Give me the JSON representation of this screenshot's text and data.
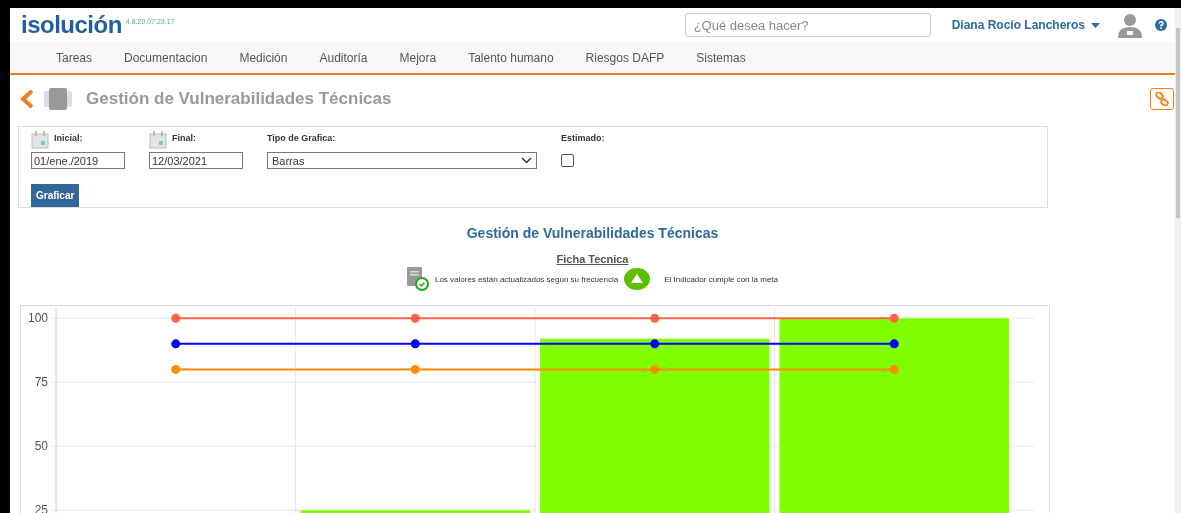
{
  "header": {
    "logo": "isolución",
    "version": "4.8.20.07.23.17",
    "search": {
      "placeholder": "¿Qué desea hacer?"
    },
    "user": "Diana Rocío Lancheros"
  },
  "nav": {
    "items": [
      "Tareas",
      "Documentacion",
      "Medición",
      "Auditoría",
      "Mejora",
      "Talento humano",
      "Riesgos DAFP",
      "Sistemas"
    ]
  },
  "page": {
    "title": "Gestión de Vulnerabilidades Técnicas"
  },
  "filters": {
    "start": {
      "label": "Inicial:",
      "value": "01/ene./2019"
    },
    "end": {
      "label": "Final:",
      "value": "12/03/2021"
    },
    "chart_type": {
      "label": "Tipo de Grafica:",
      "value": "Barras"
    },
    "estimated": {
      "label": "Estimado:",
      "checked": false
    },
    "button": "Graficar"
  },
  "report": {
    "title": "Gestión de Vulnerabilidades Técnicas",
    "sheet_link": "Ficha Tecnica",
    "legend": [
      "Los valores están actualizados según su frecuencia",
      "El Indicador cumple con la meta"
    ],
    "chart_data": {
      "type": "bar",
      "grid": true,
      "ylim": [
        23,
        104
      ],
      "yticks": [
        25,
        50,
        75,
        100
      ],
      "series": [
        {
          "type": "bar",
          "color": "#80ff00",
          "values": [
            null,
            25,
            92,
            100
          ]
        },
        {
          "type": "line",
          "marker": "circle",
          "color": "#ff6347",
          "values": [
            100,
            100,
            100,
            100
          ]
        },
        {
          "type": "line",
          "marker": "circle",
          "color": "#0000ff",
          "values": [
            90,
            90,
            90,
            90
          ]
        },
        {
          "type": "line",
          "marker": "circle",
          "color": "#ff8c00",
          "values": [
            80,
            80,
            80,
            80
          ]
        }
      ]
    }
  }
}
